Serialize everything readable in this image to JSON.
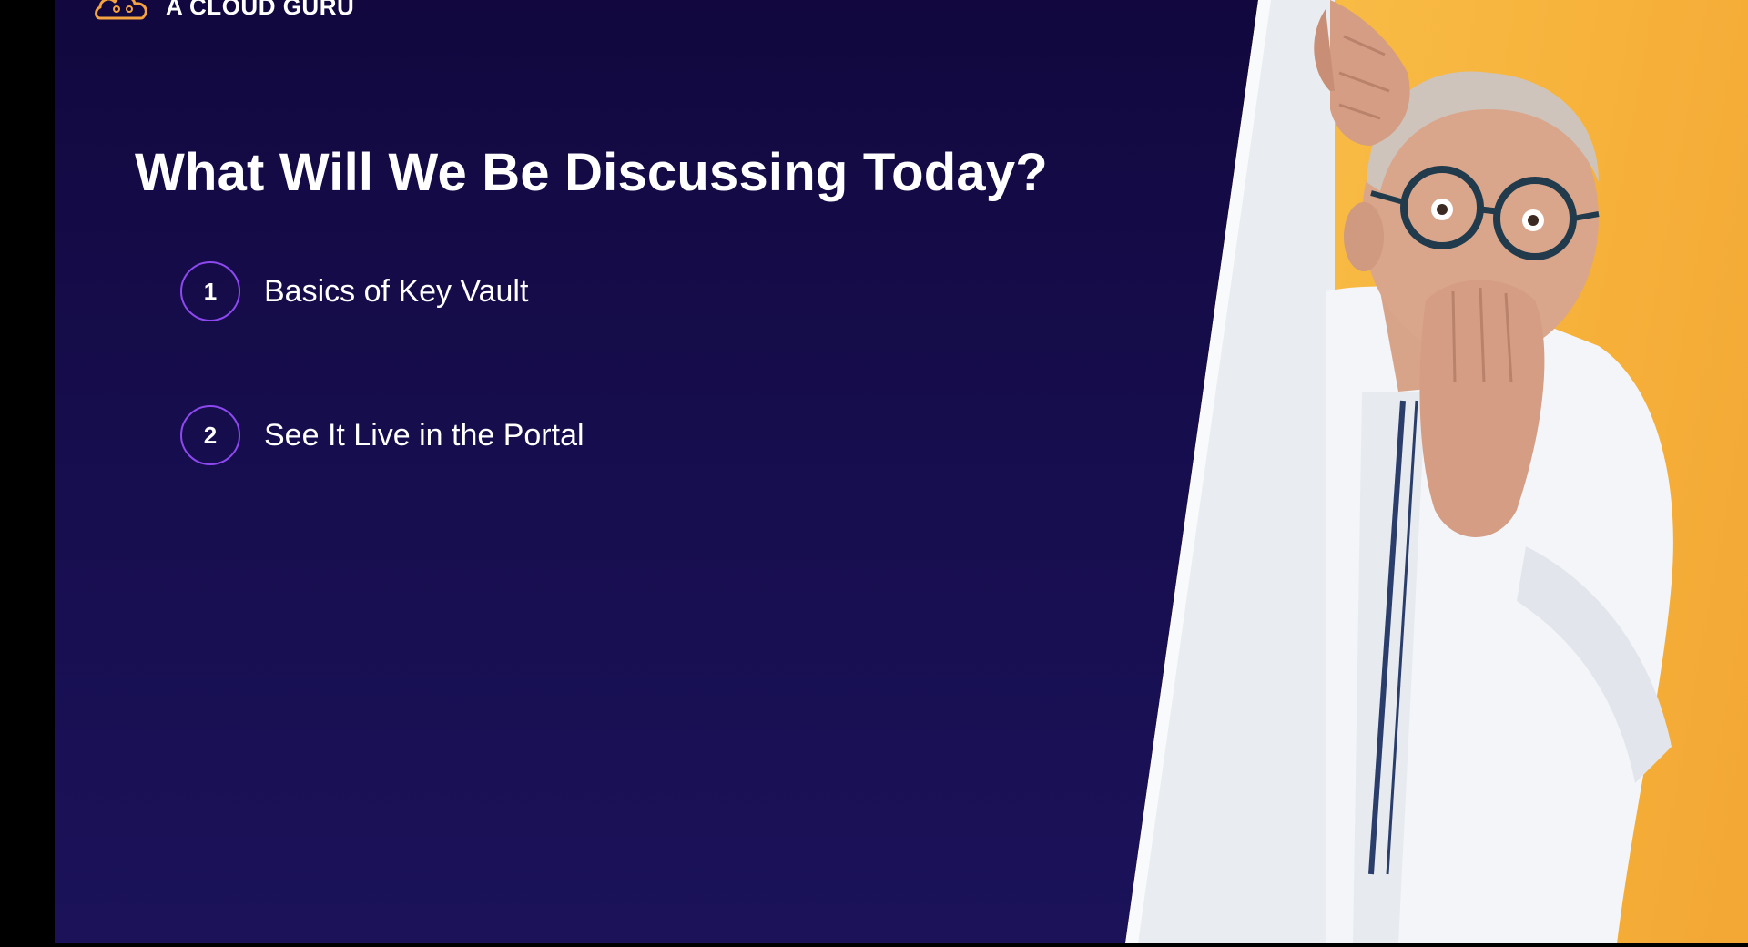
{
  "brand": {
    "name": "A CLOUD GURU",
    "accent_color": "#f4a340",
    "logo_icon": "cloud-logo-icon"
  },
  "slide": {
    "title": "What Will We Be Discussing Today?",
    "agenda": [
      {
        "number": "1",
        "label": "Basics of Key Vault"
      },
      {
        "number": "2",
        "label": "See It Live in the Portal"
      }
    ],
    "accent_color": "#8d48f0",
    "background_color": "#160d4d"
  },
  "image": {
    "subject": "surprised-man-peeking-from-white-board-icon",
    "background_color": "#f7b33c"
  }
}
